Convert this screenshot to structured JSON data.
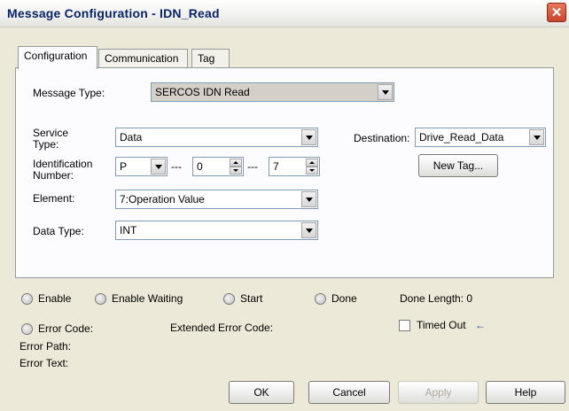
{
  "window": {
    "title": "Message Configuration - IDN_Read",
    "close_glyph": "✕"
  },
  "tabs": [
    {
      "label": "Configuration",
      "active": true
    },
    {
      "label": "Communication",
      "active": false
    },
    {
      "label": "Tag",
      "active": false
    }
  ],
  "config": {
    "message_type_label": "Message Type:",
    "message_type_value": "SERCOS IDN Read",
    "service_type_label_1": "Service",
    "service_type_label_2": "Type:",
    "service_type_value": "Data",
    "identification_label_1": "Identification",
    "identification_label_2": "Number:",
    "id_prefix": "P",
    "id_sep1": "---",
    "id_set": "0",
    "id_sep2": "---",
    "id_number": "7",
    "element_label": "Element:",
    "element_value": "7:Operation Value",
    "data_type_label": "Data Type:",
    "data_type_value": "INT",
    "destination_label": "Destination:",
    "destination_value": "Drive_Read_Data",
    "new_tag_label": "New Tag..."
  },
  "status": {
    "enable": "Enable",
    "enable_waiting": "Enable Waiting",
    "start": "Start",
    "done": "Done",
    "done_length": "Done Length: 0",
    "error_code": "Error Code:",
    "extended_error_code": "Extended Error Code:",
    "timed_out": "Timed Out",
    "timed_out_arrow": "←",
    "error_path": "Error Path:",
    "error_text": "Error Text:"
  },
  "footer": {
    "ok": "OK",
    "cancel": "Cancel",
    "apply": "Apply",
    "help": "Help"
  }
}
